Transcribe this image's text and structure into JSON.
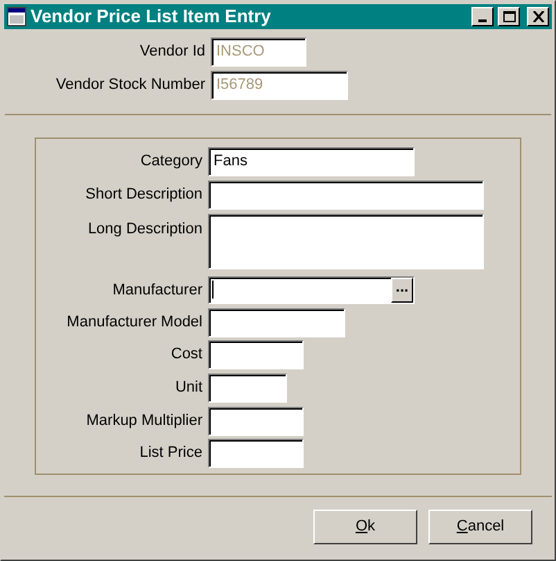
{
  "window": {
    "title": "Vendor Price List Item Entry"
  },
  "vendor_fields": [
    {
      "label": "Vendor Id",
      "value": "INSCO",
      "disabled": true,
      "kind": "text"
    },
    {
      "label": "Vendor Stock Number",
      "value": "I56789",
      "disabled": true,
      "kind": "text"
    }
  ],
  "item_fields": [
    {
      "label": "Category",
      "value": "Fans",
      "kind": "text"
    },
    {
      "label": "Short Description",
      "kind": "text"
    },
    {
      "label": "Long Description",
      "kind": "textarea"
    },
    {
      "label": "Manufacturer",
      "kind": "lookup",
      "button": "...",
      "focused": true
    },
    {
      "label": "Manufacturer Model",
      "kind": "text"
    },
    {
      "label": "Cost",
      "kind": "text"
    },
    {
      "label": "Unit",
      "kind": "text"
    },
    {
      "label": "Markup Multiplier",
      "kind": "text"
    },
    {
      "label": "List Price",
      "kind": "text"
    }
  ],
  "buttons": [
    {
      "label": "Ok",
      "underline_first": true
    },
    {
      "label": "Cancel",
      "underline_first": true
    }
  ]
}
